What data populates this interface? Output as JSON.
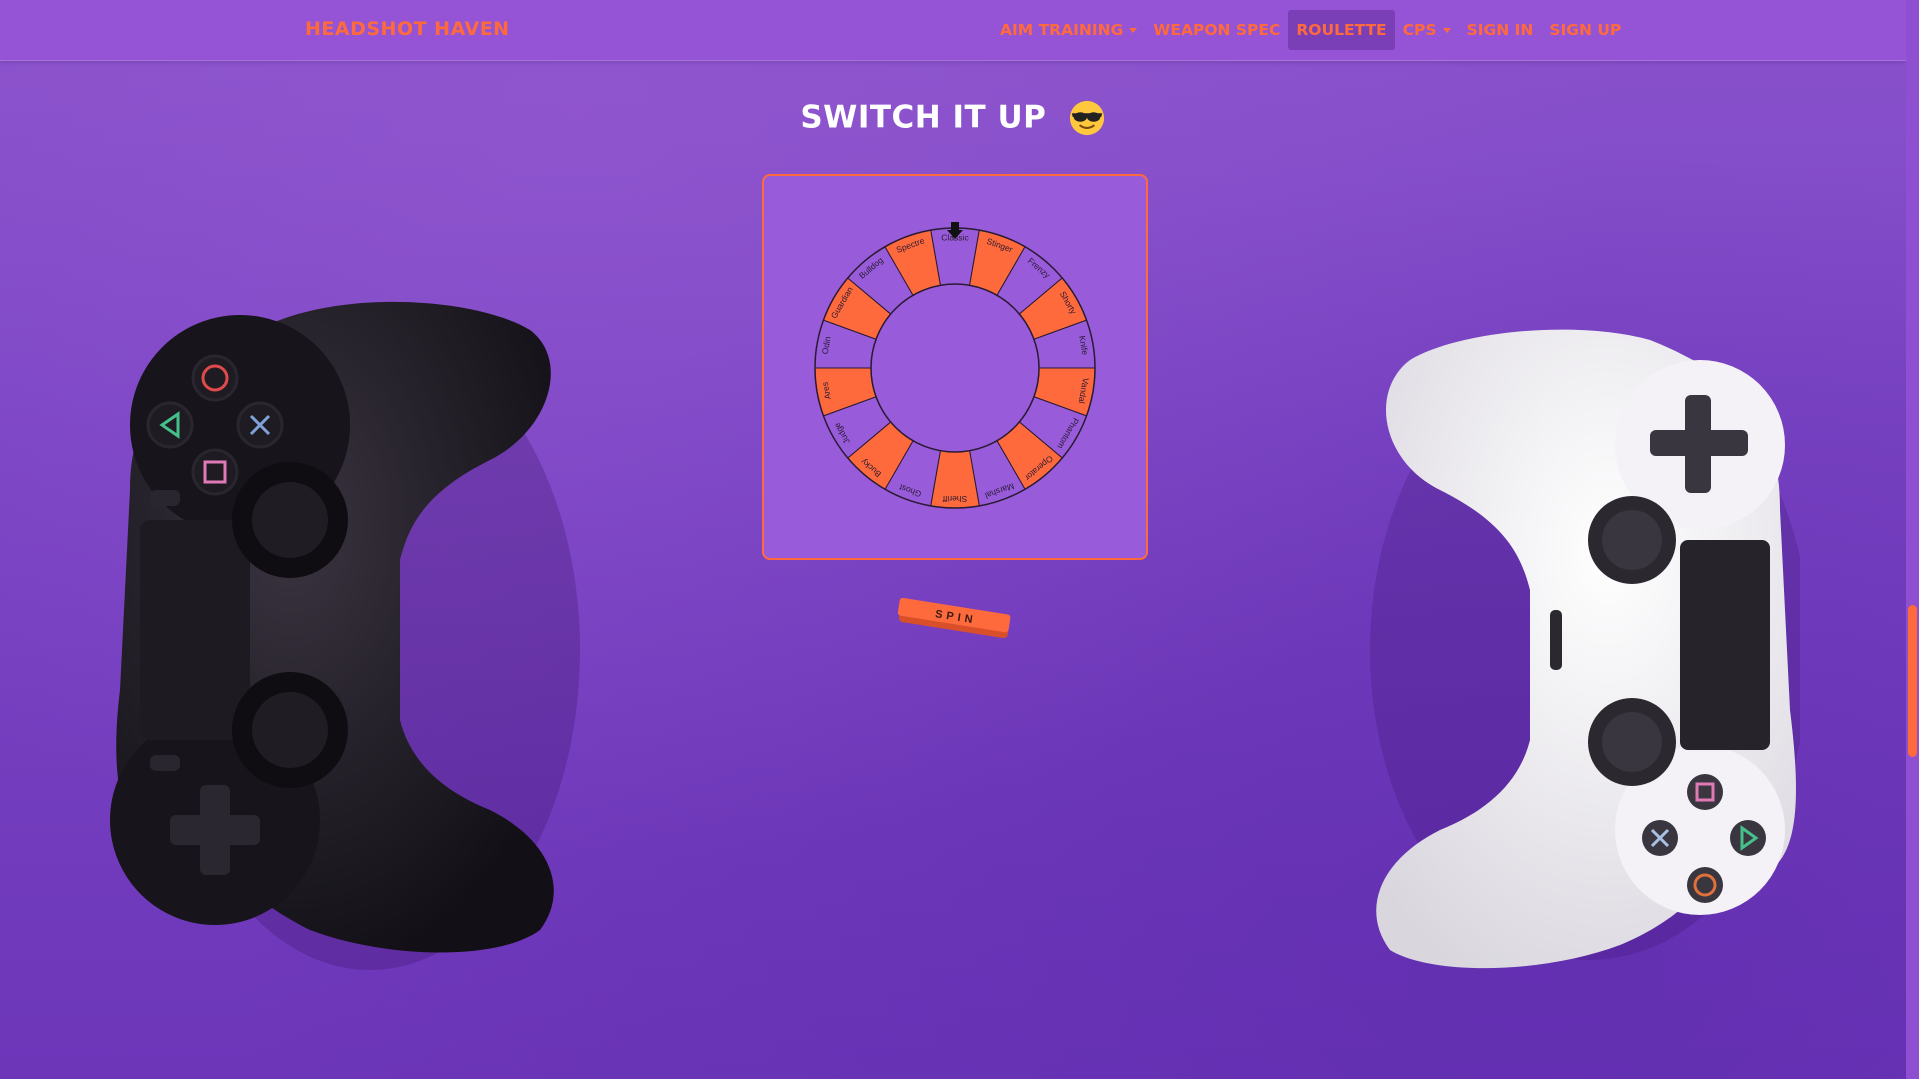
{
  "nav": {
    "brand": "HEADSHOT HAVEN",
    "items": [
      {
        "label": "AIM TRAINING",
        "dropdown": true,
        "active": false
      },
      {
        "label": "WEAPON SPEC",
        "dropdown": false,
        "active": false
      },
      {
        "label": "ROULETTE",
        "dropdown": false,
        "active": true
      },
      {
        "label": "CPS",
        "dropdown": true,
        "active": false
      },
      {
        "label": "SIGN IN",
        "dropdown": false,
        "active": false
      },
      {
        "label": "SIGN UP",
        "dropdown": false,
        "active": false
      }
    ]
  },
  "page": {
    "title": "SWITCH IT UP",
    "title_icon": "smiling-face-with-sunglasses-icon"
  },
  "wheel": {
    "pointer_icon": "arrow-down-icon",
    "segments": [
      "Classic",
      "Stinger",
      "Frenzy",
      "Shorty",
      "Knife",
      "Vandal",
      "Phantom",
      "Operator",
      "Marshal",
      "Sheriff",
      "Ghost",
      "Bucky",
      "Judge",
      "Ares",
      "Odin",
      "Guardian",
      "Bulldog",
      "Spectre"
    ]
  },
  "spin_button": {
    "label": "SPIN"
  },
  "colors": {
    "accent": "#ff6a3d",
    "background": "#7a44c4",
    "card": "#985bd9",
    "white": "#ffffff"
  }
}
